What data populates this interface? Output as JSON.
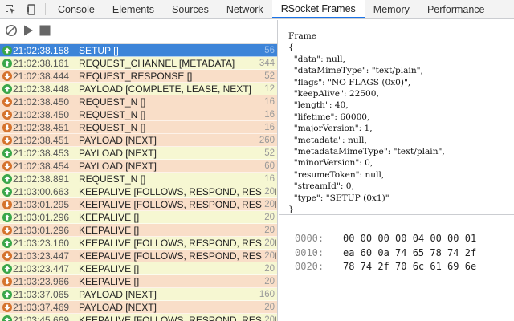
{
  "tabs": [
    {
      "label": "Console"
    },
    {
      "label": "Elements"
    },
    {
      "label": "Sources"
    },
    {
      "label": "Network"
    },
    {
      "label": "RSocket Frames"
    },
    {
      "label": "Memory"
    },
    {
      "label": "Performance"
    }
  ],
  "frames": [
    {
      "dir": "out",
      "time": "21:02:38.158",
      "name": "SETUP []",
      "size": "56",
      "selected": true
    },
    {
      "dir": "out",
      "time": "21:02:38.161",
      "name": "REQUEST_CHANNEL [METADATA]",
      "size": "344"
    },
    {
      "dir": "in",
      "time": "21:02:38.444",
      "name": "REQUEST_RESPONSE []",
      "size": "52"
    },
    {
      "dir": "out",
      "time": "21:02:38.448",
      "name": "PAYLOAD [COMPLETE, LEASE, NEXT]",
      "size": "12"
    },
    {
      "dir": "in",
      "time": "21:02:38.450",
      "name": "REQUEST_N []",
      "size": "16"
    },
    {
      "dir": "in",
      "time": "21:02:38.450",
      "name": "REQUEST_N []",
      "size": "16"
    },
    {
      "dir": "in",
      "time": "21:02:38.451",
      "name": "REQUEST_N []",
      "size": "16"
    },
    {
      "dir": "in",
      "time": "21:02:38.451",
      "name": "PAYLOAD [NEXT]",
      "size": "260"
    },
    {
      "dir": "out",
      "time": "21:02:38.453",
      "name": "PAYLOAD [NEXT]",
      "size": "52"
    },
    {
      "dir": "in",
      "time": "21:02:38.454",
      "name": "PAYLOAD [NEXT]",
      "size": "60"
    },
    {
      "dir": "out",
      "time": "21:02:38.891",
      "name": "REQUEST_N []",
      "size": "16"
    },
    {
      "dir": "out",
      "time": "21:03:00.663",
      "name": "KEEPALIVE [FOLLOWS, RESPOND, RESUME_ENABLE, METADATA]",
      "size": "20"
    },
    {
      "dir": "in",
      "time": "21:03:01.295",
      "name": "KEEPALIVE [FOLLOWS, RESPOND, RESUME_ENABLE, METADATA]",
      "size": "20"
    },
    {
      "dir": "out",
      "time": "21:03:01.296",
      "name": "KEEPALIVE []",
      "size": "20"
    },
    {
      "dir": "in",
      "time": "21:03:01.296",
      "name": "KEEPALIVE []",
      "size": "20"
    },
    {
      "dir": "out",
      "time": "21:03:23.160",
      "name": "KEEPALIVE [FOLLOWS, RESPOND, RESUME_ENABLE, METADATA]",
      "size": "20"
    },
    {
      "dir": "in",
      "time": "21:03:23.447",
      "name": "KEEPALIVE [FOLLOWS, RESPOND, RESUME_ENABLE, METADATA]",
      "size": "20"
    },
    {
      "dir": "out",
      "time": "21:03:23.447",
      "name": "KEEPALIVE []",
      "size": "20"
    },
    {
      "dir": "in",
      "time": "21:03:23.966",
      "name": "KEEPALIVE []",
      "size": "20"
    },
    {
      "dir": "out",
      "time": "21:03:37.065",
      "name": "PAYLOAD [NEXT]",
      "size": "160"
    },
    {
      "dir": "in",
      "time": "21:03:37.469",
      "name": "PAYLOAD [NEXT]",
      "size": "20"
    },
    {
      "dir": "out",
      "time": "21:03:45.669",
      "name": "KEEPALIVE [FOLLOWS, RESPOND, RESUME_ENABLE, METADATA]",
      "size": "20"
    }
  ],
  "detail": {
    "json_lines": [
      "Frame",
      "{",
      "  \"data\": null,",
      "  \"dataMimeType\": \"text/plain\",",
      "  \"flags\": \"NO FLAGS (0x0)\",",
      "  \"keepAlive\": 22500,",
      "  \"length\": 40,",
      "  \"lifetime\": 60000,",
      "  \"majorVersion\": 1,",
      "  \"metadata\": null,",
      "  \"metadataMimeType\": \"text/plain\",",
      "  \"minorVersion\": 0,",
      "  \"resumeToken\": null,",
      "  \"streamId\": 0,",
      "  \"type\": \"SETUP (0x1)\"",
      "}"
    ],
    "hex": [
      {
        "addr": "0000:",
        "bytes": "00 00 00 00 04 00 00 01"
      },
      {
        "addr": "0010:",
        "bytes": "ea 60 0a 74 65 78 74 2f"
      },
      {
        "addr": "0020:",
        "bytes": "78 74 2f 70 6c 61 69 6e"
      }
    ]
  },
  "colors": {
    "outgoing_row": "#f6f7d2",
    "incoming_row": "#f9dec8",
    "selected_row": "#3d84d8",
    "outgoing_arrow": "#3aa64a",
    "incoming_arrow": "#d5732d",
    "active_tab_underline": "#1a73e8"
  },
  "icons": {
    "toolbar": [
      "inspect-element-icon",
      "device-toggle-icon"
    ],
    "controls": [
      "clear-icon",
      "play-icon",
      "stop-icon"
    ]
  }
}
